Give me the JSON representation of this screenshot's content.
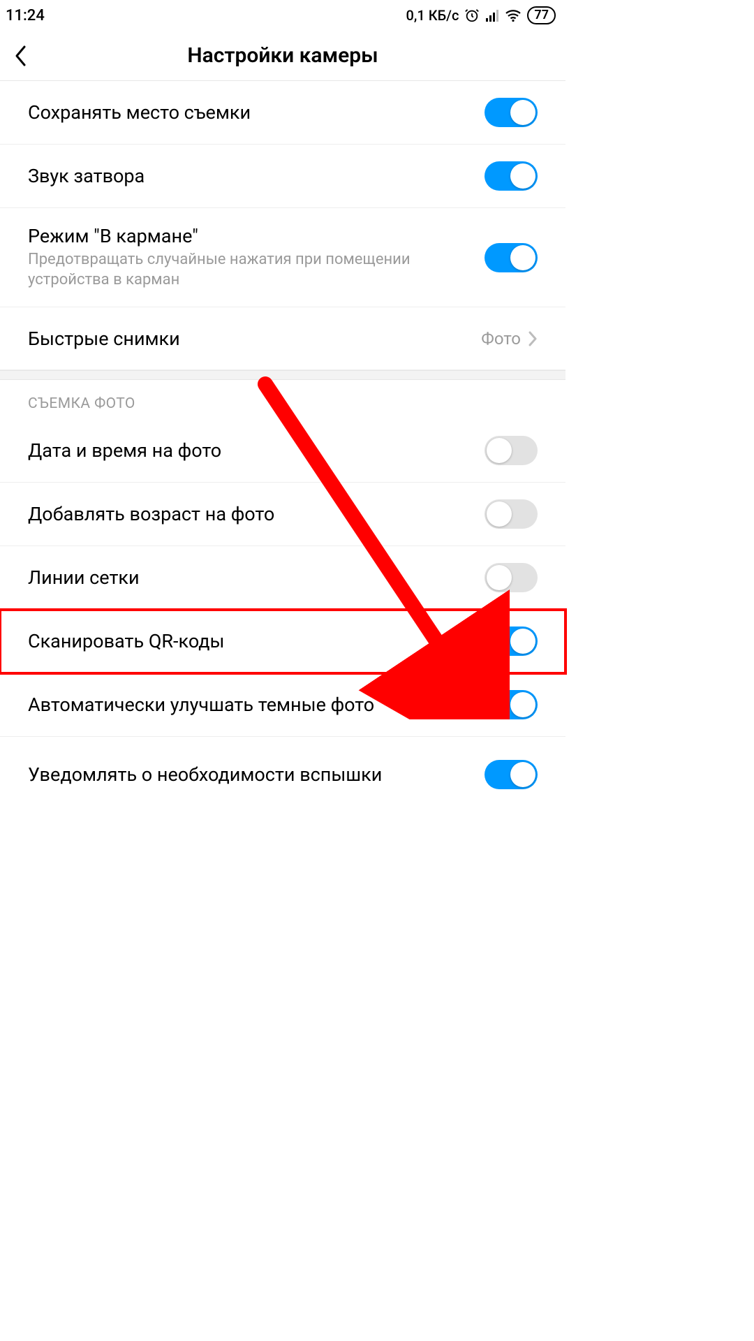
{
  "status": {
    "time": "11:24",
    "net_speed": "0,1 КБ/с",
    "battery": "77"
  },
  "header": {
    "title": "Настройки камеры"
  },
  "rows": {
    "save_location": {
      "label": "Сохранять место съемки"
    },
    "shutter_sound": {
      "label": "Звук затвора"
    },
    "pocket_mode": {
      "label": "Режим \"В кармане\"",
      "sub": "Предотвращать случайные нажатия при помещении устройства в карман"
    },
    "quick_shots": {
      "label": "Быстрые снимки",
      "value": "Фото"
    },
    "section_photo": "СЪЕМКА ФОТО",
    "timestamp": {
      "label": "Дата и время на фото"
    },
    "age_stamp": {
      "label": "Добавлять возраст на фото"
    },
    "gridlines": {
      "label": "Линии сетки"
    },
    "scan_qr": {
      "label": "Сканировать QR-коды"
    },
    "enhance_dark": {
      "label": "Автоматически улучшать темные фото"
    },
    "flash_notify": {
      "label": "Уведомлять о необходимости вспышки"
    }
  }
}
